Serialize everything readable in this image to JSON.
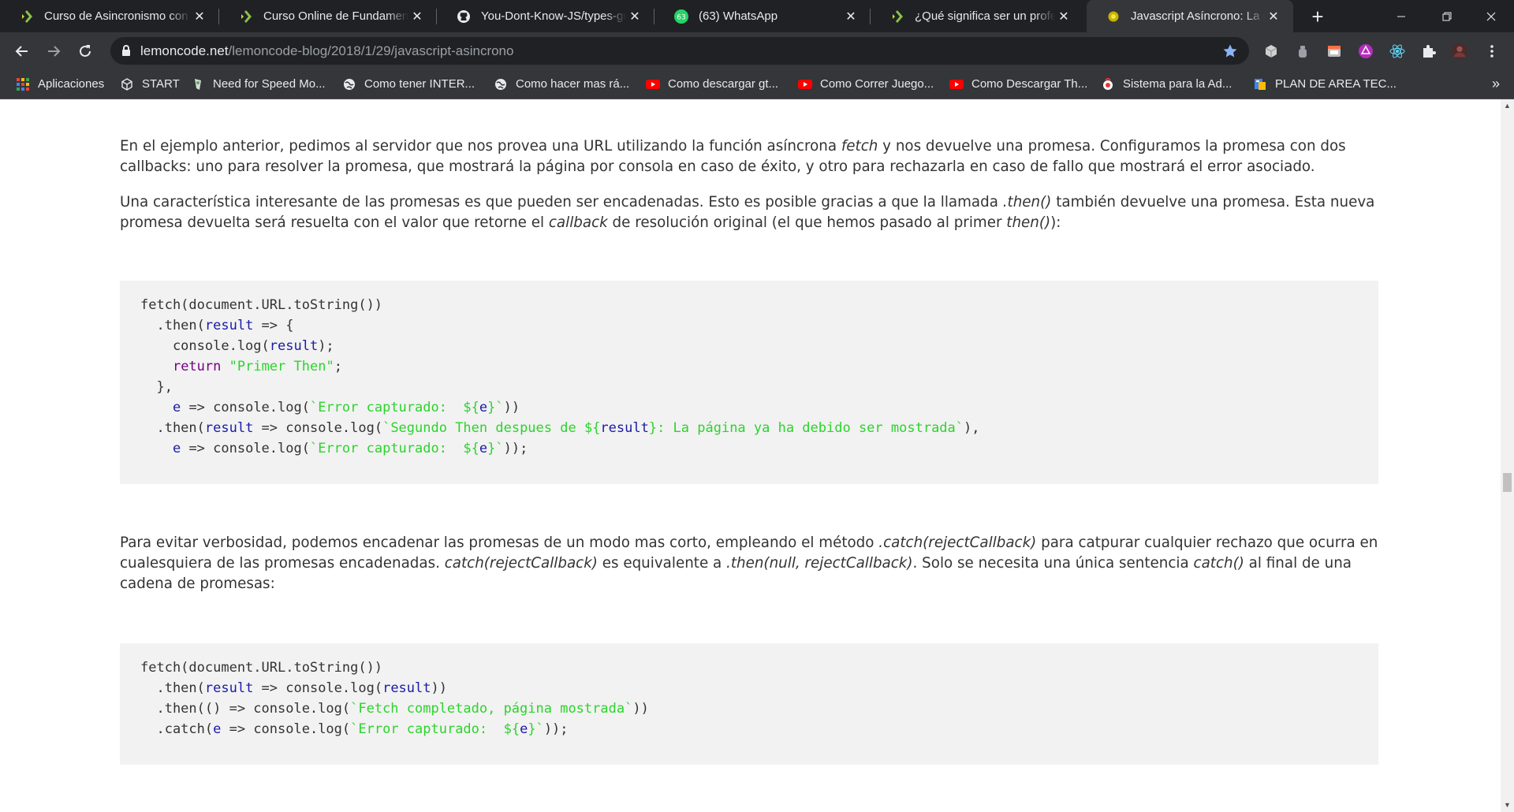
{
  "browser": {
    "tabs": [
      {
        "title": "Curso de Asincronismo con JavaScript",
        "icon": "lemoncode-icon",
        "active": false
      },
      {
        "title": "Curso Online de Fundamentos",
        "icon": "lemoncode-icon",
        "active": false
      },
      {
        "title": "You-Dont-Know-JS/types-grammar",
        "icon": "github-icon",
        "active": false
      },
      {
        "title": "(63) WhatsApp",
        "icon": "whatsapp-icon",
        "active": false
      },
      {
        "title": "¿Qué significa ser un profesional",
        "icon": "lemoncode-icon",
        "active": false
      },
      {
        "title": "Javascript Asíncrono: La guía",
        "icon": "lemoncode-icon",
        "active": true
      }
    ],
    "whatsapp_badge": "63",
    "close_glyph": "✕",
    "new_tab_glyph": "+",
    "url_host": "lemoncode.net",
    "url_path": "/lemoncode-blog/2018/1/29/javascript-asincrono",
    "bookmarks": [
      {
        "label": "Aplicaciones",
        "icon": "apps-grid-icon"
      },
      {
        "label": "START",
        "icon": "cube-icon"
      },
      {
        "label": "Need for Speed Mo...",
        "icon": "nfs-icon"
      },
      {
        "label": "Como tener INTER...",
        "icon": "globe-icon"
      },
      {
        "label": "Como hacer mas rá...",
        "icon": "globe-icon"
      },
      {
        "label": "Como descargar gt...",
        "icon": "youtube-icon"
      },
      {
        "label": "Como Correr Juego...",
        "icon": "youtube-icon"
      },
      {
        "label": "Como Descargar Th...",
        "icon": "youtube-icon"
      },
      {
        "label": "Sistema para la Ad...",
        "icon": "app-icon"
      },
      {
        "label": "PLAN DE AREA TEC...",
        "icon": "doc-icon"
      }
    ],
    "bookmarks_overflow": "»",
    "colors": {
      "tabstrip": "#202124",
      "toolbar": "#35363a",
      "youtube": "#ff0000",
      "whatsapp": "#25d366",
      "lemon": "#8bc34a",
      "star": "#8ab4f8"
    }
  },
  "article": {
    "p1": {
      "a": "En el ejemplo anterior, pedimos al servidor que nos provea una URL utilizando la función asíncrona ",
      "b": "fetch",
      "c": " y nos devuelve una promesa. Configuramos la promesa con dos callbacks: uno para resolver la promesa, que mostrará la página por consola en caso de éxito, y otro para rechazarla en caso de fallo que mostrará el error asociado."
    },
    "p2": {
      "a": "Una característica interesante de las promesas es que pueden ser encadenadas. Esto es posible gracias a que la llamada ",
      "b": ".then()",
      "c": " también devuelve una promesa. Esta nueva promesa devuelta será resuelta con el valor que retorne el ",
      "d": "callback",
      "e": " de resolución original (el que hemos pasado al primer ",
      "f": "then()",
      "g": "):"
    },
    "code1": [
      [
        {
          "t": "plain",
          "v": "fetch(document.URL.toString())"
        }
      ],
      [
        {
          "t": "plain",
          "v": "  .then("
        },
        {
          "t": "var",
          "v": "result"
        },
        {
          "t": "plain",
          "v": " => {"
        }
      ],
      [
        {
          "t": "plain",
          "v": "    console.log("
        },
        {
          "t": "var",
          "v": "result"
        },
        {
          "t": "plain",
          "v": ");"
        }
      ],
      [
        {
          "t": "plain",
          "v": "    "
        },
        {
          "t": "kw",
          "v": "return"
        },
        {
          "t": "plain",
          "v": " "
        },
        {
          "t": "str",
          "v": "\"Primer Then\""
        },
        {
          "t": "plain",
          "v": ";"
        }
      ],
      [
        {
          "t": "plain",
          "v": "  },"
        }
      ],
      [
        {
          "t": "plain",
          "v": "    "
        },
        {
          "t": "var",
          "v": "e"
        },
        {
          "t": "plain",
          "v": " => console.log("
        },
        {
          "t": "str",
          "v": "`Error capturado:  ${"
        },
        {
          "t": "var",
          "v": "e"
        },
        {
          "t": "str",
          "v": "}`"
        },
        {
          "t": "plain",
          "v": "))"
        }
      ],
      [
        {
          "t": "plain",
          "v": "  .then("
        },
        {
          "t": "var",
          "v": "result"
        },
        {
          "t": "plain",
          "v": " => console.log("
        },
        {
          "t": "str",
          "v": "`Segundo Then despues de ${"
        },
        {
          "t": "var",
          "v": "result"
        },
        {
          "t": "str",
          "v": "}: La página ya ha debido ser mostrada`"
        },
        {
          "t": "plain",
          "v": "),"
        }
      ],
      [
        {
          "t": "plain",
          "v": "    "
        },
        {
          "t": "var",
          "v": "e"
        },
        {
          "t": "plain",
          "v": " => console.log("
        },
        {
          "t": "str",
          "v": "`Error capturado:  ${"
        },
        {
          "t": "var",
          "v": "e"
        },
        {
          "t": "str",
          "v": "}`"
        },
        {
          "t": "plain",
          "v": "));"
        }
      ]
    ],
    "p3": {
      "a": "Para evitar verbosidad, podemos encadenar las promesas de un modo mas corto, empleando el método ",
      "b": ".catch(rejectCallback)",
      "c": " para catpurar cualquier rechazo que ocurra en cualesquiera de las promesas encadenadas. ",
      "d": "catch(rejectCallback)",
      "e": " es equivalente a ",
      "f": ".then(null, rejectCallback)",
      "g": ". Solo se necesita una única sentencia ",
      "h": "catch()",
      "i": " al final de una cadena de promesas:"
    },
    "code2": [
      [
        {
          "t": "plain",
          "v": "fetch(document.URL.toString())"
        }
      ],
      [
        {
          "t": "plain",
          "v": "  .then("
        },
        {
          "t": "var",
          "v": "result"
        },
        {
          "t": "plain",
          "v": " => console.log("
        },
        {
          "t": "var",
          "v": "result"
        },
        {
          "t": "plain",
          "v": "))"
        }
      ],
      [
        {
          "t": "plain",
          "v": "  .then(() => console.log("
        },
        {
          "t": "str",
          "v": "`Fetch completado, página mostrada`"
        },
        {
          "t": "plain",
          "v": "))"
        }
      ],
      [
        {
          "t": "plain",
          "v": "  .catch("
        },
        {
          "t": "var",
          "v": "e"
        },
        {
          "t": "plain",
          "v": " => console.log("
        },
        {
          "t": "str",
          "v": "`Error capturado:  ${"
        },
        {
          "t": "var",
          "v": "e"
        },
        {
          "t": "str",
          "v": "}`"
        },
        {
          "t": "plain",
          "v": "));"
        }
      ]
    ]
  }
}
